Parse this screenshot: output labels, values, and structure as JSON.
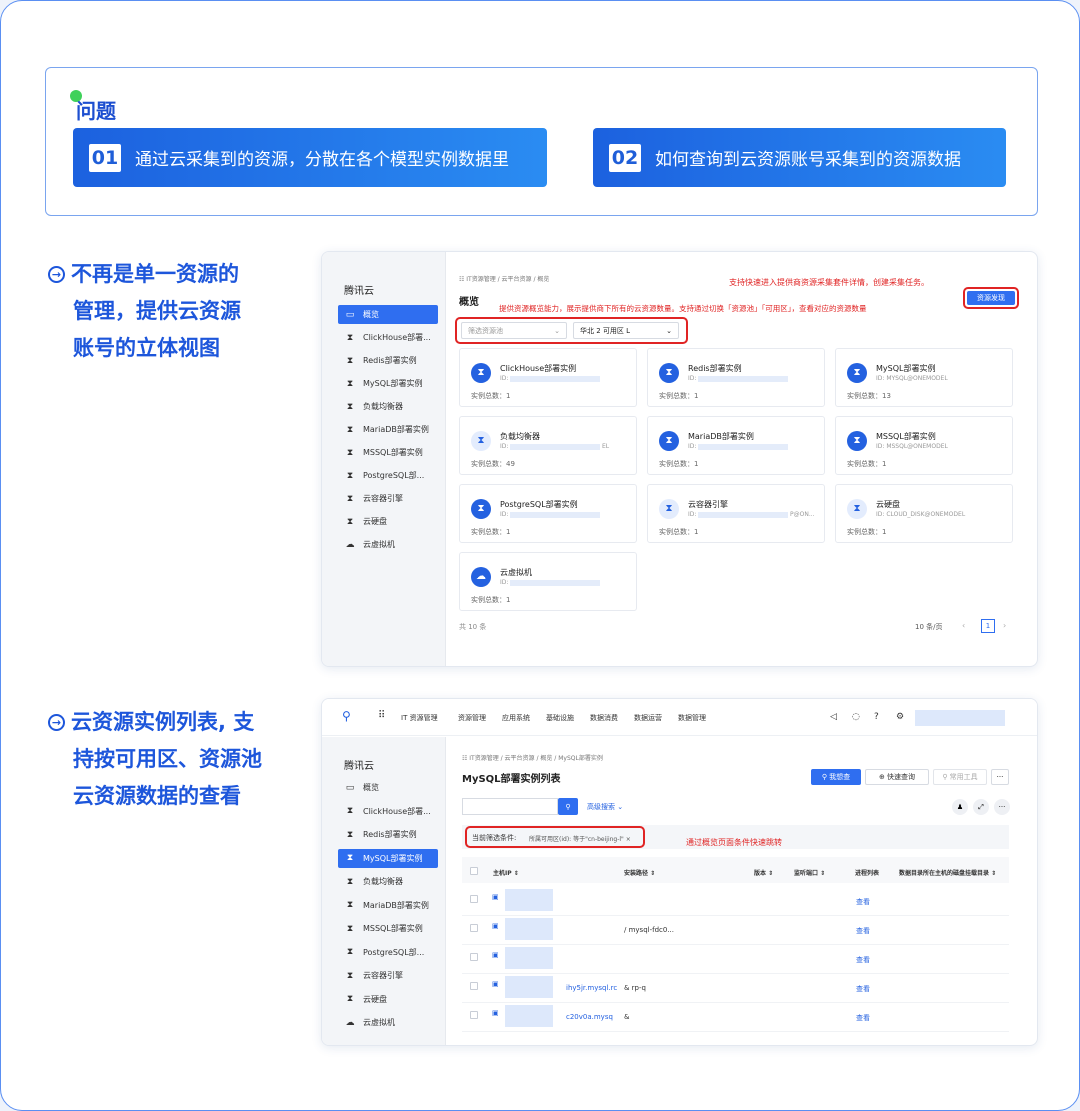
{
  "problem": {
    "title": "问题",
    "items": [
      {
        "num": "01",
        "text": "通过云采集到的资源，分散在各个模型实例数据里"
      },
      {
        "num": "02",
        "text": "如何查询到云资源账号采集到的资源数据"
      }
    ]
  },
  "bullets": [
    {
      "lines": [
        "不再是单一资源的",
        "管理，提供云资源",
        "账号的立体视图"
      ]
    },
    {
      "lines": [
        "云资源实例列表, 支",
        "持按可用区、资源池",
        "云资源数据的查看"
      ]
    }
  ],
  "shot1": {
    "brand": "腾讯云",
    "nav": [
      {
        "icon": "▭",
        "label": "概览",
        "active": true
      },
      {
        "icon": "⧗",
        "label": "ClickHouse部署..."
      },
      {
        "icon": "⧗",
        "label": "Redis部署实例"
      },
      {
        "icon": "⧗",
        "label": "MySQL部署实例"
      },
      {
        "icon": "⧗",
        "label": "负载均衡器"
      },
      {
        "icon": "⧗",
        "label": "MariaDB部署实例"
      },
      {
        "icon": "⧗",
        "label": "MSSQL部署实例"
      },
      {
        "icon": "⧗",
        "label": "PostgreSQL部..."
      },
      {
        "icon": "⧗",
        "label": "云容器引擎"
      },
      {
        "icon": "⧗",
        "label": "云硬盘"
      },
      {
        "icon": "☁",
        "label": "云虚拟机"
      }
    ],
    "breadcrumb": "☷ IT资源管理 / 云平台资源 / 概览",
    "title": "概览",
    "note_top": "支持快速进入提供商资源采集套件详情，创建采集任务。",
    "note_mid": "提供资源概览能力，展示提供商下所有的云资源数量。支持通过切换「资源池」「可用区」，查看对应的资源数量",
    "discover_button": "资源发现",
    "pool_placeholder": "筛选资源池",
    "zone_value": "华北 2 可用区 L",
    "cards": [
      {
        "name": "ClickHouse部署实例",
        "id": "ID:",
        "count": "实例总数：1"
      },
      {
        "name": "Redis部署实例",
        "id": "ID:",
        "count": "实例总数：1"
      },
      {
        "name": "MySQL部署实例",
        "id": "ID:  MYSQL@ONEMODEL",
        "count": "实例总数：13"
      },
      {
        "name": "负载均衡器",
        "id": "ID:",
        "suffix": "EL",
        "count": "实例总数：49"
      },
      {
        "name": "MariaDB部署实例",
        "id": "ID:",
        "count": "实例总数：1"
      },
      {
        "name": "MSSQL部署实例",
        "id": "ID:  MSSQL@ONEMODEL",
        "count": "实例总数：1"
      },
      {
        "name": "PostgreSQL部署实例",
        "id": "ID:",
        "count": "实例总数：1"
      },
      {
        "name": "云容器引擎",
        "id": "ID:",
        "suffix": "P@ON...",
        "count": "实例总数：1"
      },
      {
        "name": "云硬盘",
        "id": "ID:  CLOUD_DISK@ONEMODEL",
        "count": "实例总数：1"
      },
      {
        "name": "云虚拟机",
        "id": "ID:",
        "count": "实例总数：1"
      }
    ],
    "total": "共 10 条",
    "page_size": "10 条/页",
    "page": "1"
  },
  "shot2": {
    "topnav": [
      "IT 资源管理",
      "资源管理",
      "应用系统",
      "基础设施",
      "数据消费",
      "数据运营",
      "数据管理"
    ],
    "brand": "腾讯云",
    "nav": [
      {
        "icon": "▭",
        "label": "概览"
      },
      {
        "icon": "⧗",
        "label": "ClickHouse部署..."
      },
      {
        "icon": "⧗",
        "label": "Redis部署实例"
      },
      {
        "icon": "⧗",
        "label": "MySQL部署实例",
        "active": true
      },
      {
        "icon": "⧗",
        "label": "负载均衡器"
      },
      {
        "icon": "⧗",
        "label": "MariaDB部署实例"
      },
      {
        "icon": "⧗",
        "label": "MSSQL部署实例"
      },
      {
        "icon": "⧗",
        "label": "PostgreSQL部..."
      },
      {
        "icon": "⧗",
        "label": "云容器引擎"
      },
      {
        "icon": "⧗",
        "label": "云硬盘"
      },
      {
        "icon": "☁",
        "label": "云虚拟机"
      }
    ],
    "breadcrumb": "☷ IT资源管理 / 云平台资源 / 概览 / MySQL部署实例",
    "title": "MySQL部署实例列表",
    "btn_mine": "我想查",
    "btn_quick": "快速查询",
    "btn_tools": "常用工具",
    "btn_more": "···",
    "advanced": "高级搜索",
    "filter_label": "当前筛选条件:",
    "filter_value": "所属可用区(id): 等于\"cn-beijing-l\" ×",
    "note": "通过概览页面条件快速跳转",
    "columns": [
      "主机IP",
      "安装路径",
      "版本",
      "监听端口",
      "进程列表",
      "数据目录所在主机的磁盘挂载目录"
    ],
    "rows": [
      {
        "path": "",
        "action": "查看"
      },
      {
        "path": "/                        mysql-fdc0...",
        "action": "查看"
      },
      {
        "path": "",
        "action": "查看"
      },
      {
        "host": "ihy5jr.mysql.rc",
        "path": "&          rp-q",
        "action": "查看"
      },
      {
        "host": "c20v0a.mysq",
        "path": "&",
        "action": "查看"
      }
    ]
  }
}
